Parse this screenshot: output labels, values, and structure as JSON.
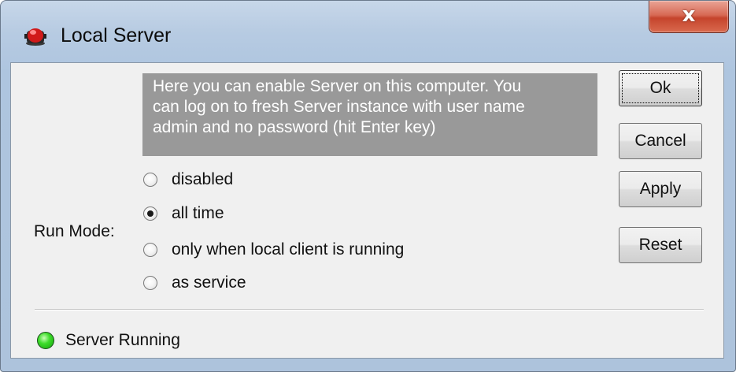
{
  "window": {
    "title": "Local Server",
    "close_glyph": "x",
    "title_icon": "red-server-icon"
  },
  "info": {
    "lines": [
      "Here you can enable Server on this computer. You",
      "can log on to fresh Server instance with user name",
      "admin and no password (hit Enter key)"
    ]
  },
  "run_mode": {
    "label": "Run Mode:",
    "options": [
      {
        "label": "disabled",
        "checked": false
      },
      {
        "label": "all time",
        "checked": true
      },
      {
        "label": "only when local client is running",
        "checked": false
      },
      {
        "label": "as service",
        "checked": false
      }
    ]
  },
  "buttons": {
    "ok": "Ok",
    "cancel": "Cancel",
    "apply": "Apply",
    "reset": "Reset"
  },
  "status": {
    "text": "Server Running",
    "icon": "green-status-led-icon",
    "color": "#2ecc1a"
  },
  "colors": {
    "info_bg": "#999999",
    "close_button": "#c5442c"
  }
}
